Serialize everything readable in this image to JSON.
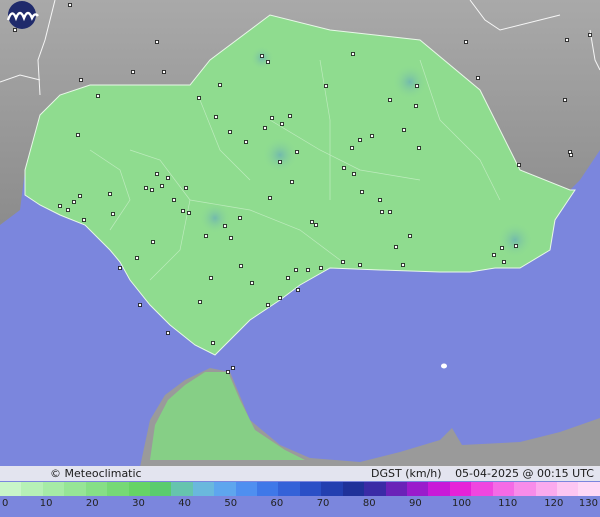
{
  "map": {
    "credit": "© Meteoclimatic",
    "variable": "DGST (km/h)",
    "datetime": "05-04-2025 @ 00:15 UTC",
    "colors": {
      "sea": "#7b86dd",
      "land_outside": "#9a9a9a",
      "region": "#8fdc8f",
      "border": "#ffffff"
    },
    "logo_icon": "meteoclimatic-logo-icon",
    "station_icon": "station-marker-icon"
  },
  "legend": {
    "ticks": [
      "0",
      "10",
      "20",
      "30",
      "40",
      "50",
      "60",
      "70",
      "80",
      "90",
      "100",
      "110",
      "120",
      "130"
    ],
    "colors": [
      "#c8f5c8",
      "#b6f0b6",
      "#a6eba6",
      "#96e596",
      "#86df86",
      "#76d976",
      "#66d466",
      "#5acc6e",
      "#66c4ae",
      "#6ab8dd",
      "#5ea6ee",
      "#4f8ff0",
      "#3f78e8",
      "#3462d8",
      "#2a4fc6",
      "#233fb0",
      "#1f3199",
      "#3a2ba6",
      "#6a22b8",
      "#9a1ccc",
      "#c81ad8",
      "#e622d8",
      "#f046e0",
      "#f56ae6",
      "#f88cea",
      "#fbaaee",
      "#fdc6f2",
      "#fed8f6"
    ]
  }
}
